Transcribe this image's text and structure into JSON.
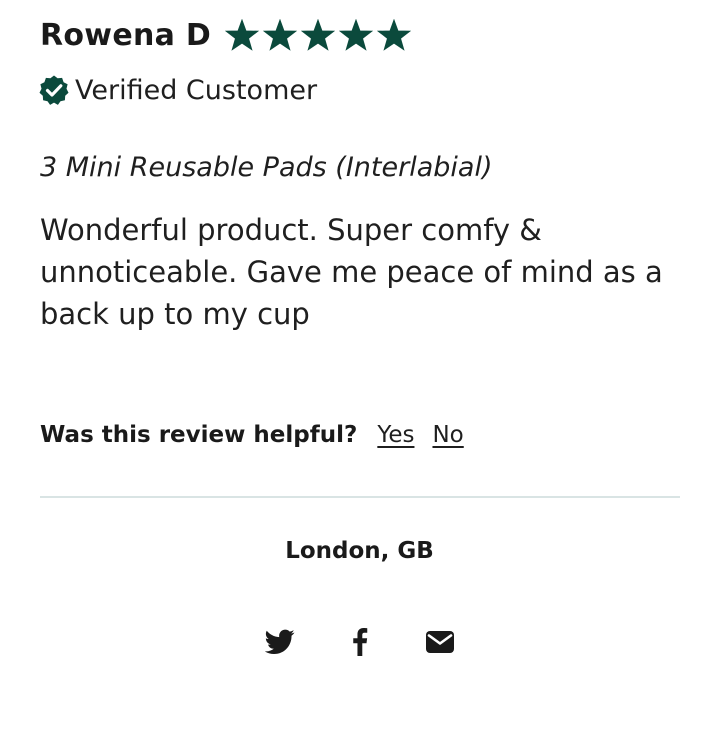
{
  "reviewer": {
    "name": "Rowena D",
    "rating": 5,
    "max_rating": 5,
    "verified_label": "Verified Customer"
  },
  "review": {
    "product": "3 Mini Reusable Pads (Interlabial)",
    "body": "Wonderful product. Super comfy & unnoticeable. Gave me peace of mind as a back up to my cup"
  },
  "helpful": {
    "question": "Was this review helpful?",
    "yes_label": "Yes",
    "no_label": "No"
  },
  "location": "London, GB",
  "share": {
    "icons": [
      "twitter-icon",
      "facebook-icon",
      "email-icon"
    ]
  },
  "colors": {
    "star": "#0b4a3c",
    "verified_badge": "#0b4a3c",
    "divider": "#d9e4e4",
    "text": "#1f1f1f"
  }
}
